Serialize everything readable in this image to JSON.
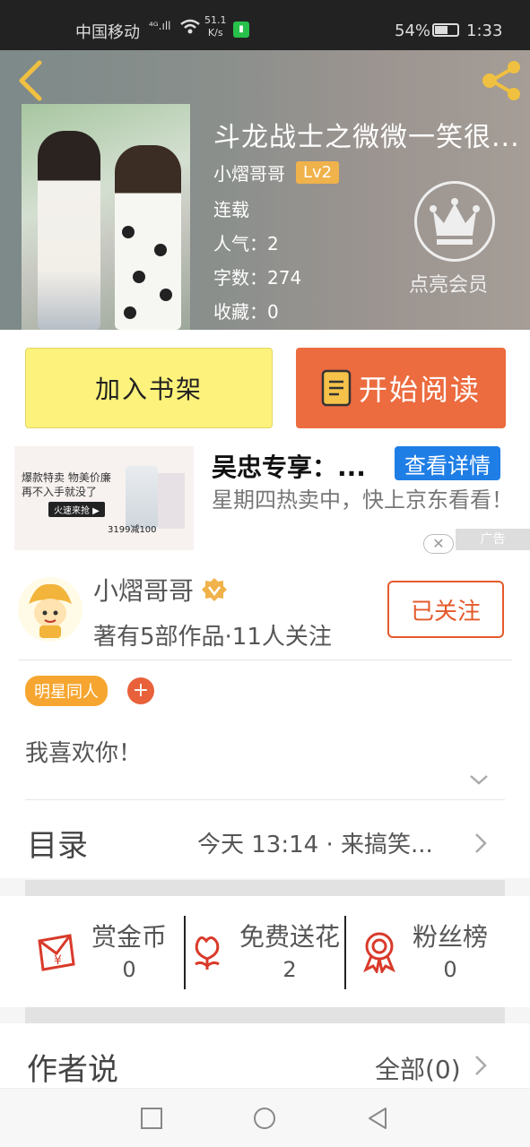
{
  "status_bar": {
    "carrier": "中国移动",
    "signal": "⁴ᴳ.ıll",
    "speed_value": "51.1",
    "speed_unit": "K/s",
    "battery": "54%",
    "time": "1:33"
  },
  "book": {
    "title": "斗龙战士之微微一笑很...",
    "author": "小熠哥哥",
    "level": "Lv2",
    "status": "连载",
    "popularity": "人气：2",
    "word_count": "字数：274",
    "favorites": "收藏：0",
    "vip_label": "点亮会员"
  },
  "actions": {
    "add_shelf": "加入书架",
    "start_reading": "开始阅读"
  },
  "ad": {
    "img_line1": "爆款特卖  物美价廉",
    "img_line2": "再不入手就没了",
    "img_button": "火速来抢 ▶",
    "img_price": "3199减100",
    "title": "吴忠专享：...",
    "button": "查看详情",
    "description": "星期四热卖中，快上京东看看！",
    "close": "✕",
    "tag": "广告"
  },
  "author_card": {
    "name": "小熠哥哥",
    "stats": "著有5部作品·11人关注",
    "follow": "已关注",
    "tag": "明星同人",
    "tag_add": "+",
    "intro": "我喜欢你！"
  },
  "toc": {
    "label": "目录",
    "latest": "今天 13:14 · 来搞笑..."
  },
  "stats": [
    {
      "label": "赏金币",
      "value": "0"
    },
    {
      "label": "免费送花",
      "value": "2"
    },
    {
      "label": "粉丝榜",
      "value": "0"
    }
  ],
  "author_says": {
    "label": "作者说",
    "all": "全部(0)"
  },
  "colors": {
    "accent": "#ec6b3f",
    "shelf": "#fdf27b",
    "ad_button": "#1f7ee6",
    "level_badge": "#f0b24a"
  }
}
